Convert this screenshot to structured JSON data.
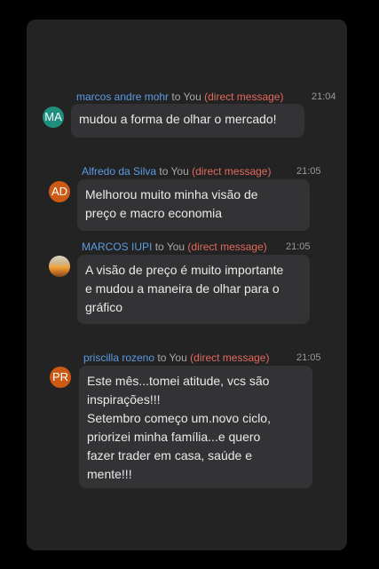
{
  "messages": [
    {
      "avatar_text": "MA",
      "avatar_color": "#1f8f7e",
      "sender": "marcos andre mohr",
      "to": "to You",
      "dm": "(direct message)",
      "time": "21:04",
      "text": "mudou a forma de olhar o mercado!"
    },
    {
      "avatar_text": "AD",
      "avatar_color": "#cc5a14",
      "sender": "Alfredo da Silva",
      "to": "to You",
      "dm": "(direct message)",
      "time": "21:05",
      "text": "Melhorou muito minha visão de\npreço e macro economia"
    },
    {
      "avatar_text": "",
      "avatar_icon": "profile-photo",
      "sender": "MARCOS IUPI",
      "to": "to You",
      "dm": "(direct message)",
      "time": "21:05",
      "text": "A visão de preço é muito importante\ne mudou a maneira de olhar para o\ngráfico"
    },
    {
      "avatar_text": "PR",
      "avatar_color": "#cc5a14",
      "sender": "priscilla rozeno",
      "to": "to You",
      "dm": "(direct message)",
      "time": "21:05",
      "text": "Este mês...tomei atitude, vcs são\ninspirações!!!\nSetembro começo um.novo ciclo,\npriorizei minha família...e quero\nfazer trader em casa, saúde e\nmente!!!"
    }
  ]
}
